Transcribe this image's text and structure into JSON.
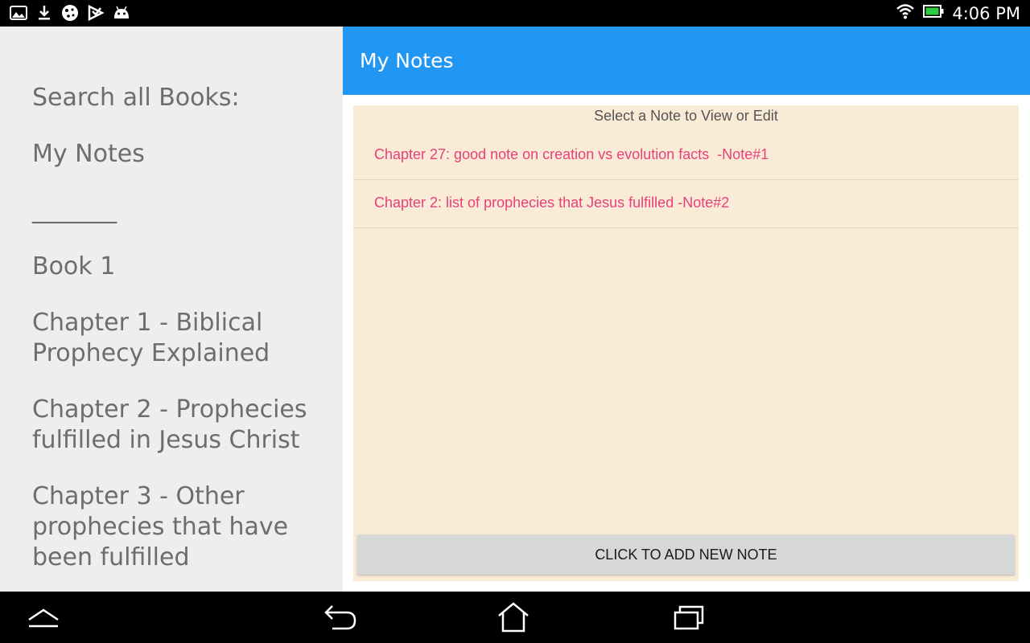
{
  "status_bar": {
    "time": "4:06 PM",
    "icons": [
      "gallery-icon",
      "download-icon",
      "cookie-icon",
      "play-store-icon",
      "android-icon",
      "wifi-icon",
      "battery-icon"
    ]
  },
  "drawer": {
    "items": [
      {
        "label": "Search all Books:"
      },
      {
        "label": "My Notes"
      },
      {
        "label": "_______"
      },
      {
        "label": "Book 1"
      },
      {
        "label": "Chapter 1 - Biblical Prophecy Explained"
      },
      {
        "label": "Chapter 2 - Prophecies fulfilled in Jesus Christ"
      },
      {
        "label": "Chapter 3 - Other prophecies that have been fulfilled"
      }
    ]
  },
  "app_bar": {
    "title": "My Notes",
    "color": "#2196f3"
  },
  "notes": {
    "header": "Select a Note to View or Edit",
    "items": [
      {
        "text": "Chapter 27: good note on creation vs evolution facts  -Note#1"
      },
      {
        "text": "Chapter 2: list of prophecies that Jesus fulfilled -Note#2"
      }
    ],
    "add_button": "CLICK TO ADD NEW NOTE",
    "background": "#faebd7",
    "item_color": "#e8407a"
  },
  "nav_bar": {
    "icons": [
      "collapse-up-icon",
      "back-icon",
      "home-icon",
      "recent-apps-icon"
    ]
  }
}
